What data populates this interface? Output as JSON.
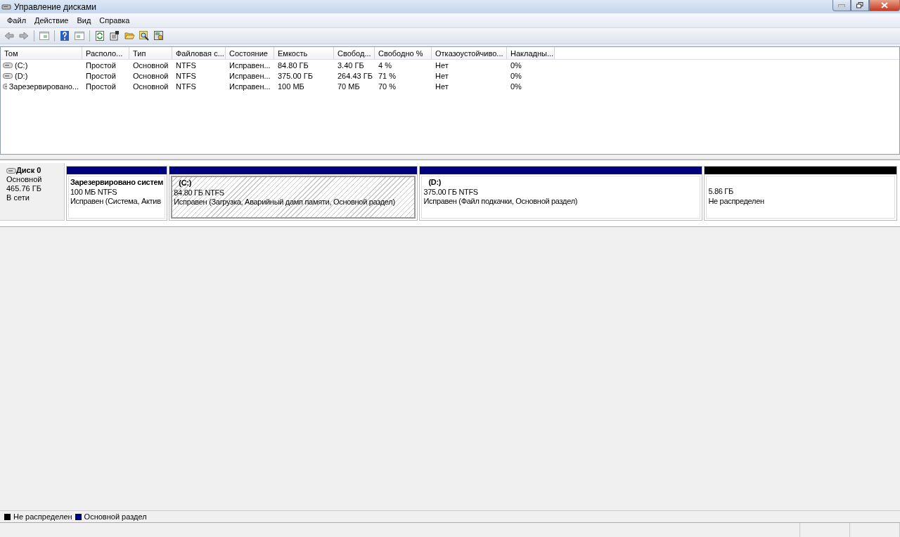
{
  "window": {
    "title": "Управление дисками"
  },
  "menu": [
    "Файл",
    "Действие",
    "Вид",
    "Справка"
  ],
  "volumes": {
    "columns": [
      "Том",
      "Располо...",
      "Тип",
      "Файловая с...",
      "Состояние",
      "Емкость",
      "Свобод...",
      "Свободно %",
      "Отказоустойчиво...",
      "Накладны..."
    ],
    "rows": [
      {
        "cells": [
          "(C:)",
          "Простой",
          "Основной",
          "NTFS",
          "Исправен...",
          "84.80 ГБ",
          "3.40 ГБ",
          "4 %",
          "Нет",
          "0%"
        ]
      },
      {
        "cells": [
          "(D:)",
          "Простой",
          "Основной",
          "NTFS",
          "Исправен...",
          "375.00 ГБ",
          "264.43 ГБ",
          "71 %",
          "Нет",
          "0%"
        ]
      },
      {
        "cells": [
          "Зарезервировано...",
          "Простой",
          "Основной",
          "NTFS",
          "Исправен...",
          "100 МБ",
          "70 МБ",
          "70 %",
          "Нет",
          "0%"
        ]
      }
    ]
  },
  "disks": [
    {
      "name": "Диск 0",
      "type": "Основной",
      "size": "465.76 ГБ",
      "status": "В сети",
      "partitions": [
        {
          "kind": "primary",
          "name": "Зарезервировано систем",
          "size": "100 МБ NTFS",
          "status": "Исправен (Система, Актив",
          "selected": false
        },
        {
          "kind": "primary",
          "name": "(C:)",
          "size": "84.80 ГБ NTFS",
          "status": "Исправен (Загрузка, Аварийный дамп памяти, Основной раздел)",
          "selected": true
        },
        {
          "kind": "primary",
          "name": "(D:)",
          "size": "375.00 ГБ NTFS",
          "status": "Исправен (Файл подкачки, Основной раздел)",
          "selected": false
        },
        {
          "kind": "unallocated",
          "size": "5.86 ГБ",
          "status": "Не распределен",
          "selected": false
        }
      ]
    }
  ],
  "legend": [
    {
      "label": "Не распределен",
      "color": "#000000"
    },
    {
      "label": "Основной раздел",
      "color": "#00007f"
    }
  ]
}
